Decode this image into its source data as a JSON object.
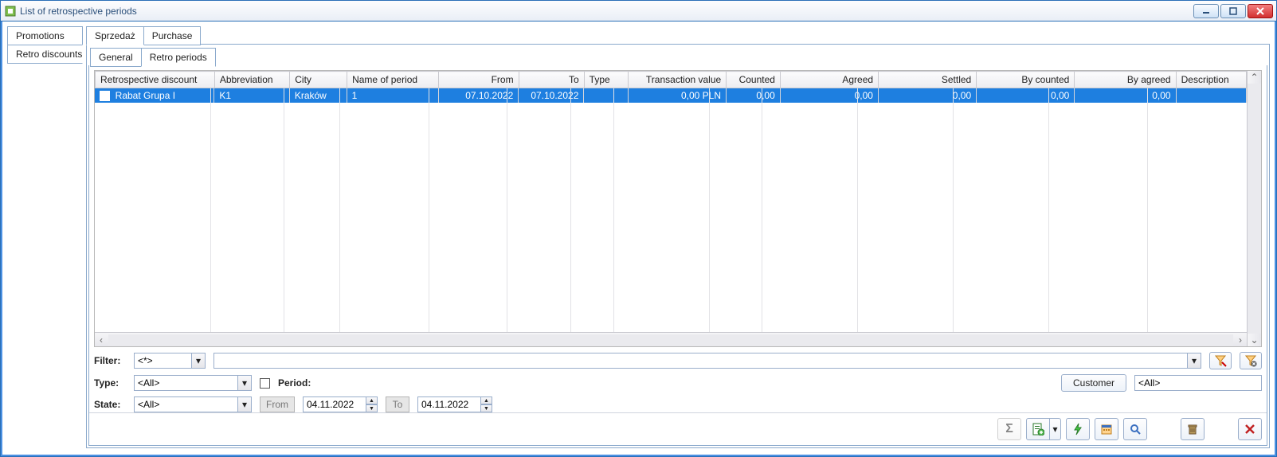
{
  "window": {
    "title": "List of retrospective periods"
  },
  "side_tabs": {
    "promotions": "Promotions",
    "retro_discounts": "Retro discounts"
  },
  "main_tabs": {
    "sprzedaz": "Sprzedaż",
    "purchase": "Purchase"
  },
  "sub_tabs": {
    "general": "General",
    "retro_periods": "Retro periods"
  },
  "grid": {
    "headers": {
      "retrospective_discount": "Retrospective discount",
      "abbreviation": "Abbreviation",
      "city": "City",
      "name_of_period": "Name of period",
      "from": "From",
      "to": "To",
      "type": "Type",
      "transaction_value": "Transaction value",
      "counted": "Counted",
      "agreed": "Agreed",
      "settled": "Settled",
      "by_counted": "By counted",
      "by_agreed": "By agreed",
      "description": "Description"
    },
    "row": {
      "retrospective_discount": "Rabat Grupa I",
      "abbreviation": "K1",
      "city": "Kraków",
      "name_of_period": "1",
      "from": "07.10.2022",
      "to": "07.10.2022",
      "type": "",
      "transaction_value": "0,00 PLN",
      "counted": "0,00",
      "agreed": "0,00",
      "settled": "0,00",
      "by_counted": "0,00",
      "by_agreed": "0,00",
      "description": ""
    }
  },
  "filters": {
    "filter_label": "Filter:",
    "filter_value": "<*>",
    "type_label": "Type:",
    "type_value": "<All>",
    "state_label": "State:",
    "state_value": "<All>",
    "period_label": "Period:",
    "from_label": "From",
    "to_label": "To",
    "from_date": "04.11.2022",
    "to_date": "04.11.2022",
    "customer_button": "Customer",
    "customer_value": "<All>"
  }
}
